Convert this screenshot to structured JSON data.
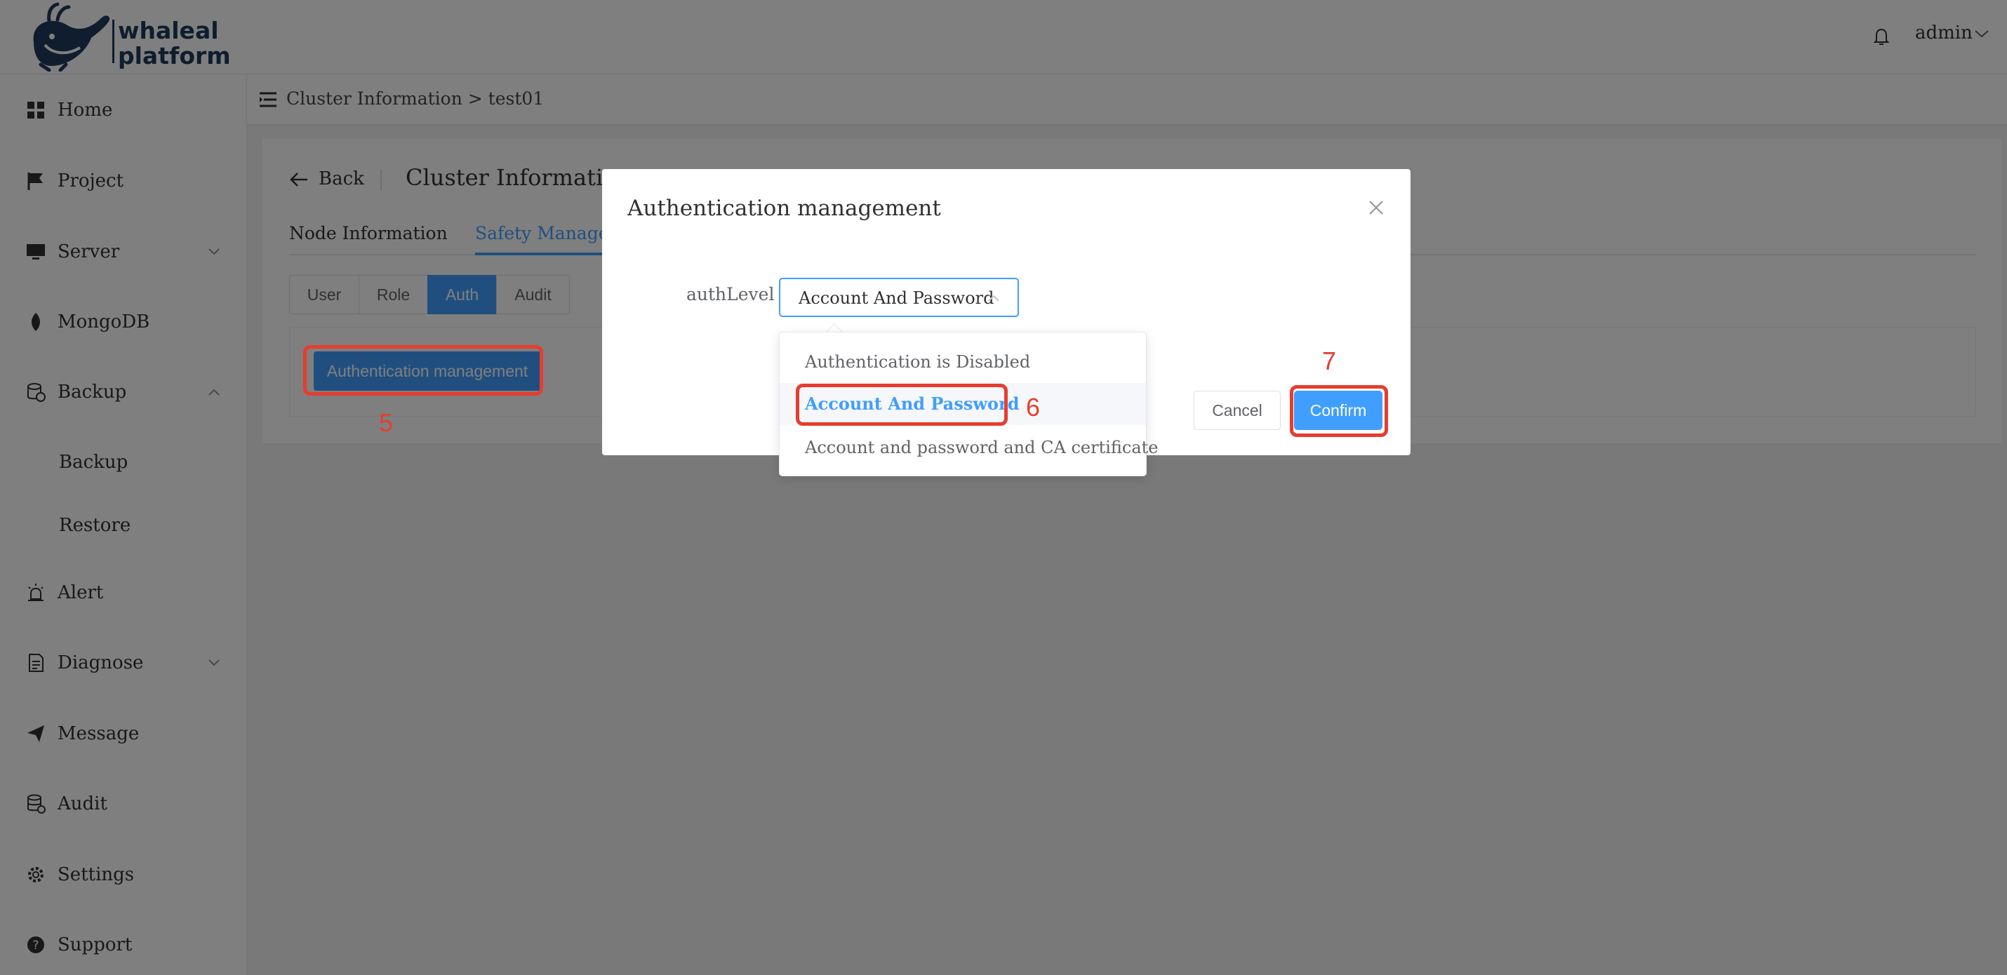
{
  "header": {
    "logo_line1": "whaleal",
    "logo_line2": "platform",
    "user_name": "admin"
  },
  "sidebar": {
    "items": [
      {
        "label": "Home"
      },
      {
        "label": "Project"
      },
      {
        "label": "Server"
      },
      {
        "label": "MongoDB"
      },
      {
        "label": "Backup"
      },
      {
        "label": "Backup"
      },
      {
        "label": "Restore"
      },
      {
        "label": "Alert"
      },
      {
        "label": "Diagnose"
      },
      {
        "label": "Message"
      },
      {
        "label": "Audit"
      },
      {
        "label": "Settings"
      },
      {
        "label": "Support"
      }
    ]
  },
  "breadcrumb": "Cluster Information > test01",
  "page": {
    "back_label": "Back",
    "title": "Cluster Information",
    "tabs": [
      {
        "label": "Node Information"
      },
      {
        "label": "Safety Manageme"
      }
    ],
    "segments": [
      {
        "label": "User"
      },
      {
        "label": "Role"
      },
      {
        "label": "Auth"
      },
      {
        "label": "Audit"
      }
    ],
    "auth_button": "Authentication management"
  },
  "dialog": {
    "title": "Authentication management",
    "field_label": "authLevel",
    "select_value": "Account And Password",
    "options": [
      {
        "label": "Authentication is Disabled"
      },
      {
        "label": "Account And Password"
      },
      {
        "label": "Account and password and CA certificate"
      }
    ],
    "cancel_label": "Cancel",
    "confirm_label": "Confirm"
  },
  "annotations": {
    "step5": "5",
    "step6": "6",
    "step7": "7",
    "color": "#e63d2e"
  },
  "colors": {
    "primary": "#409eff",
    "brand": "#1f3a5c"
  }
}
